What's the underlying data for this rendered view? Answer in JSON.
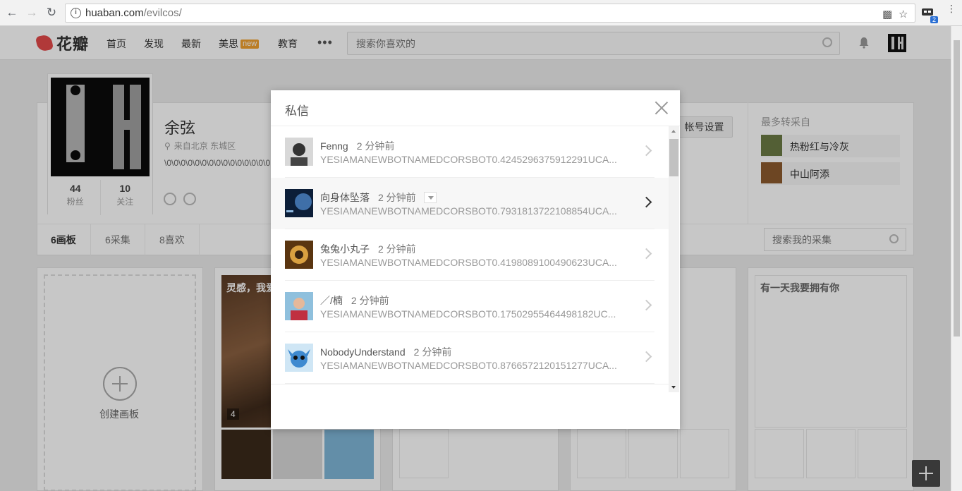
{
  "browser": {
    "url_host": "huaban.com",
    "url_path": "/evilcos/",
    "extension_badge": "2"
  },
  "site": {
    "logo_text": "花瓣",
    "nav": [
      "首页",
      "发现",
      "最新",
      "美思",
      "教育"
    ],
    "new_badge": "new",
    "more": "•••",
    "search_placeholder": "搜索你喜欢的"
  },
  "profile": {
    "name": "余弦",
    "location": "来自北京 东城区",
    "bio": "\\0\\0\\0\\0\\0\\0\\0\\0\\0\\0\\0\\0\\0\\0\\0",
    "followers_count": "44",
    "followers_label": "粉丝",
    "following_count": "10",
    "following_label": "关注",
    "settings_button": "帐号设置",
    "repin_title": "最多转采自",
    "repin_sources": [
      {
        "name": "热粉红与冷灰",
        "color": "#6b7a45"
      },
      {
        "name": "中山阿添",
        "color": "#8c5a2e"
      }
    ],
    "tabs": [
      "6画板",
      "6采集",
      "8喜欢"
    ],
    "board_search_placeholder": "搜索我的采集"
  },
  "boards": {
    "create_label": "创建画板",
    "board1_title": "灵感，我爱",
    "board1_count": "4",
    "board4_title": "有一天我要拥有你"
  },
  "modal": {
    "title": "私信",
    "messages": [
      {
        "name": "Fenng",
        "time": "2 分钟前",
        "preview": "YESIAMANEWBOTNAMEDCORSBOT0.4245296375912291UCA...",
        "avatar_color": "#555"
      },
      {
        "name": "向身体坠落",
        "time": "2 分钟前",
        "preview": "YESIAMANEWBOTNAMEDCORSBOT0.7931813722108854UCA...",
        "avatar_color": "#1a3a66"
      },
      {
        "name": "兔兔小丸子",
        "time": "2 分钟前",
        "preview": "YESIAMANEWBOTNAMEDCORSBOT0.4198089100490623UCA...",
        "avatar_color": "#8a5a20"
      },
      {
        "name": "／/楠",
        "time": "2 分钟前",
        "preview": "YESIAMANEWBOTNAMEDCORSBOT0.17502955464498182UC...",
        "avatar_color": "#6aa0c8"
      },
      {
        "name": "NobodyUnderstand",
        "time": "2 分钟前",
        "preview": "YESIAMANEWBOTNAMEDCORSBOT0.8766572120151277UCA...",
        "avatar_color": "#3f8ad0"
      }
    ]
  }
}
